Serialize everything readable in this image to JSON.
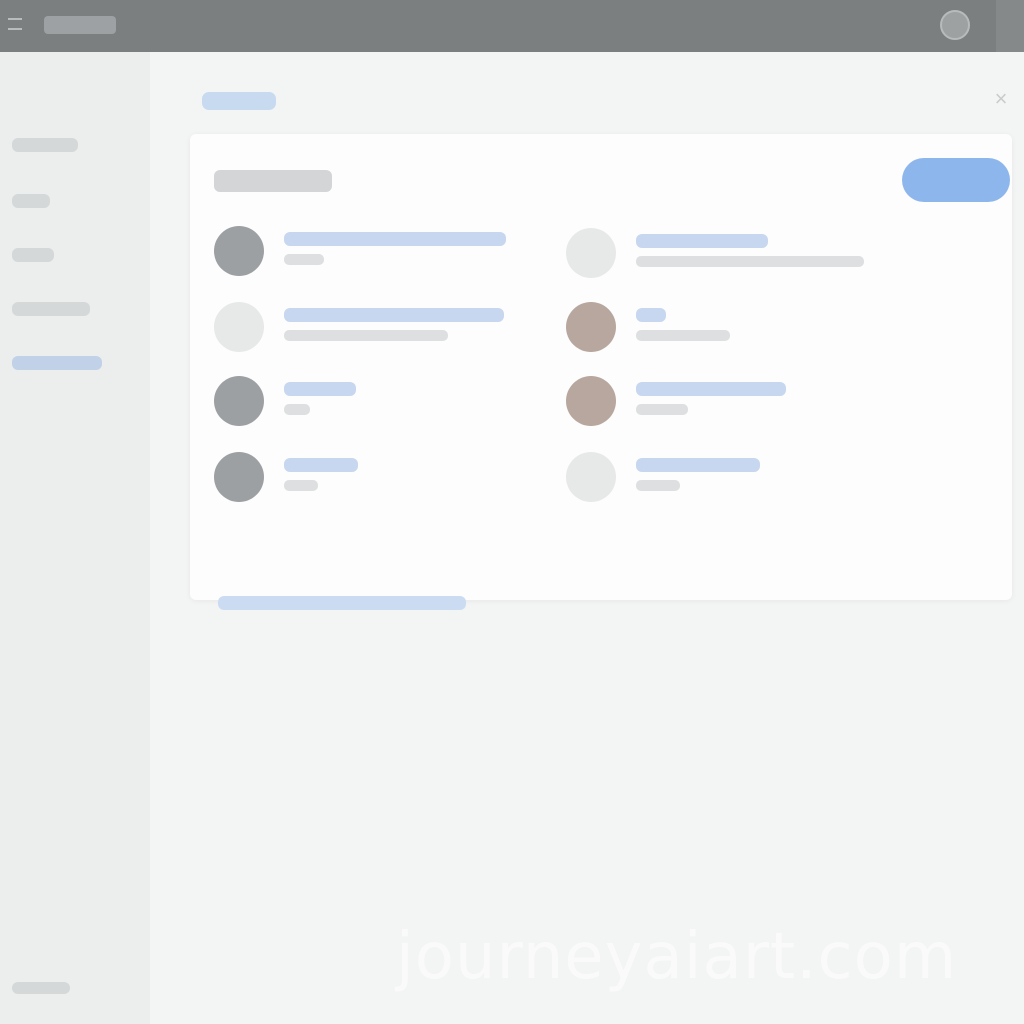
{
  "colors": {
    "topbar": "#7b7f80",
    "accent": "#8db7ec",
    "link": "#c6d7ef",
    "sidebar": "#eceeee",
    "background": "#f1f2f2"
  },
  "topbar": {
    "icons": [
      "menu-icon",
      "avatar"
    ]
  },
  "sidebar": {
    "items": [
      {
        "icon": "nav-item",
        "active": false
      },
      {
        "icon": "nav-item",
        "active": false
      },
      {
        "icon": "nav-item",
        "active": false
      },
      {
        "icon": "nav-item",
        "active": false
      },
      {
        "icon": "nav-item",
        "active": true
      }
    ]
  },
  "main": {
    "close_icon": "×"
  },
  "watermark": {
    "text": "journeyaiart.com"
  }
}
